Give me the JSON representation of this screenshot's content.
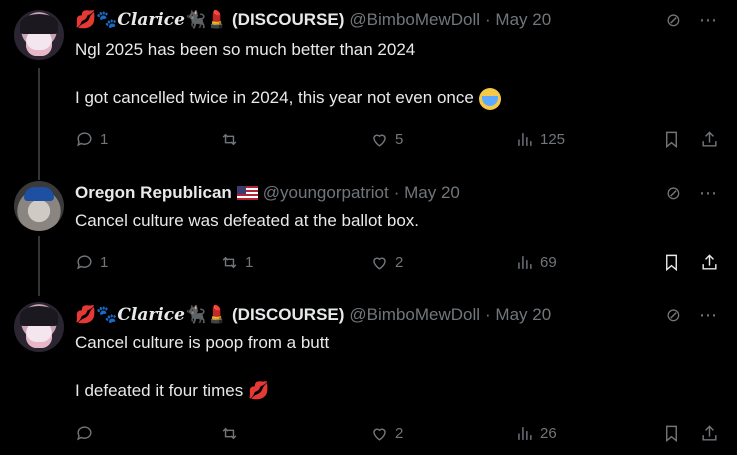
{
  "posts": [
    {
      "name_prefix": "💋🐾",
      "name_styled": "Clarice",
      "name_suffix": "🐈‍⬛💄",
      "name_main": "(DISCOURSE)",
      "handle": "@BimboMewDoll",
      "date": "· May 20",
      "text": "Ngl 2025 has been so much better than 2024\n\nI got cancelled twice in 2024, this year not even once",
      "stats": {
        "replies": "1",
        "reposts": "",
        "likes": "5",
        "views": "125"
      }
    },
    {
      "name_main": "Oregon Republican",
      "handle": "@youngorpatriot",
      "date": "· May 20",
      "text": "Cancel culture was defeated at the ballot box.",
      "stats": {
        "replies": "1",
        "reposts": "1",
        "likes": "2",
        "views": "69"
      }
    },
    {
      "name_prefix": "💋🐾",
      "name_styled": "Clarice",
      "name_suffix": "🐈‍⬛💄",
      "name_main": "(DISCOURSE)",
      "handle": "@BimboMewDoll",
      "date": "· May 20",
      "text": "Cancel culture is poop from a butt\n\nI defeated it four times",
      "text_emoji": "💋",
      "stats": {
        "replies": "",
        "reposts": "",
        "likes": "2",
        "views": "26"
      }
    }
  ],
  "icons": {
    "grok": "grok-icon",
    "more": "more-icon",
    "reply": "reply-icon",
    "repost": "repost-icon",
    "like": "like-icon",
    "views": "views-icon",
    "bookmark": "bookmark-icon",
    "share": "share-icon"
  },
  "colors": {
    "background": "#000000",
    "text": "#e7e9ea",
    "muted": "#71767b",
    "lips": "#e0245e"
  }
}
